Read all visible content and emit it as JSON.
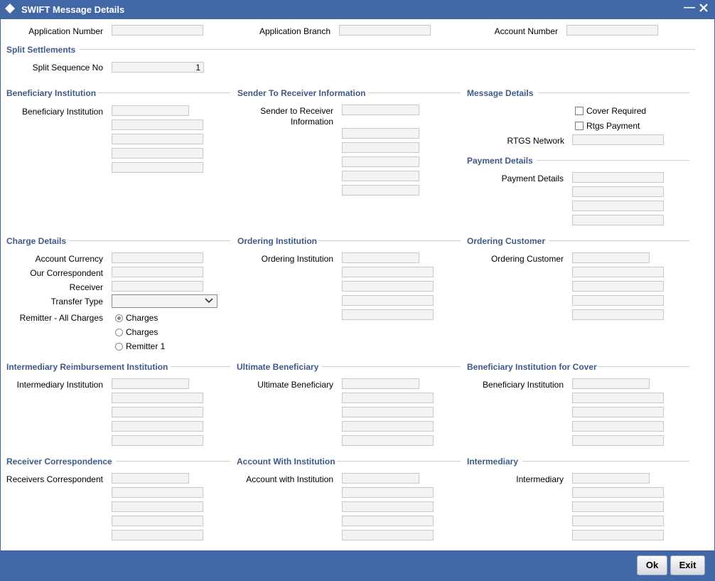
{
  "window": {
    "title": "SWIFT Message Details"
  },
  "header": {
    "application_number_label": "Application Number",
    "application_branch_label": "Application Branch",
    "account_number_label": "Account Number"
  },
  "split": {
    "section": "Split Settlements",
    "seq_label": "Split Sequence No",
    "seq_value": "1"
  },
  "beneficiary_institution": {
    "section": "Beneficiary Institution",
    "label": "Beneficiary Institution"
  },
  "sender_to_receiver": {
    "section": "Sender To Receiver Information",
    "label_line1": "Sender to Receiver",
    "label_line2": "Information"
  },
  "message_details": {
    "section": "Message Details",
    "cover_required": "Cover Required",
    "rtgs_payment": "Rtgs Payment",
    "rtgs_network": "RTGS Network"
  },
  "payment_details": {
    "section": "Payment Details",
    "label": "Payment Details"
  },
  "charge_details": {
    "section": "Charge Details",
    "account_currency": "Account Currency",
    "our_correspondent": "Our Correspondent",
    "receiver": "Receiver",
    "transfer_type": "Transfer Type",
    "remitter_all_charges": "Remitter - All Charges",
    "radio_options": [
      "Charges",
      "Charges",
      "Remitter 1"
    ]
  },
  "ordering_institution": {
    "section": "Ordering Institution",
    "label": "Ordering Institution"
  },
  "ordering_customer": {
    "section": "Ordering Customer",
    "label": "Ordering Customer"
  },
  "intermediary_reimbursement": {
    "section": "Intermediary Reimbursement Institution",
    "label": "Intermediary Institution"
  },
  "ultimate_beneficiary": {
    "section": "Ultimate Beneficiary",
    "label": "Ultimate Beneficiary"
  },
  "beneficiary_for_cover": {
    "section": "Beneficiary Institution for Cover",
    "label": "Beneficiary Institution"
  },
  "receiver_correspondence": {
    "section": "Receiver Correspondence",
    "label": "Receivers Correspondent"
  },
  "account_with_institution": {
    "section": "Account With Institution",
    "label": "Account with Institution"
  },
  "intermediary": {
    "section": "Intermediary",
    "label": "Intermediary"
  },
  "footer": {
    "ok": "Ok",
    "exit": "Exit"
  },
  "colors": {
    "title_bar": "#4267a6",
    "section_text": "#3d5a8a",
    "field_bg": "#f3f3f3"
  },
  "icons": {
    "app": "diamond-logo-icon",
    "minimize": "minimize-icon",
    "close": "close-icon",
    "dropdown": "chevron-down-icon"
  }
}
